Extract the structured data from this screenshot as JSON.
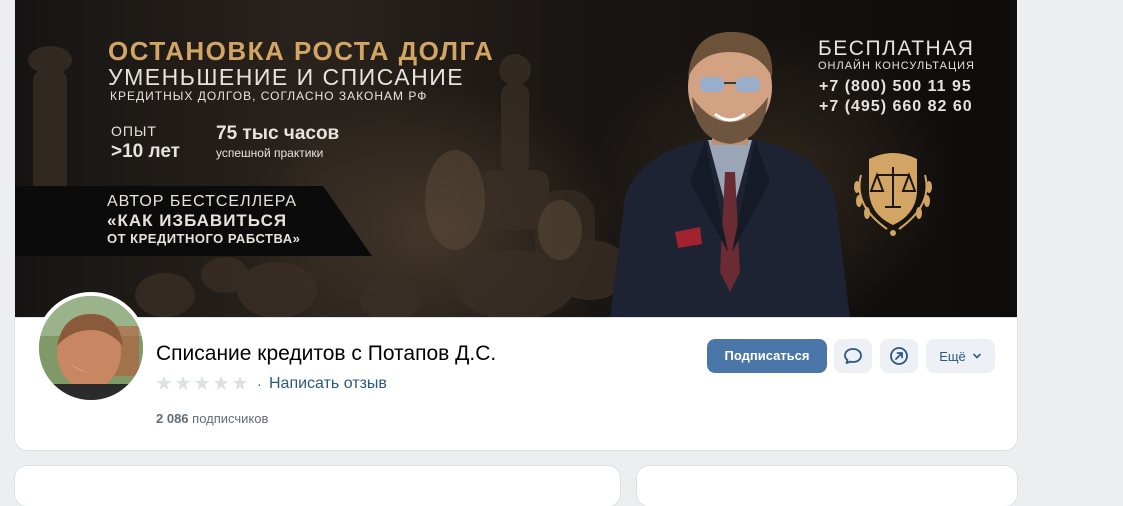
{
  "cover": {
    "headline": "ОСТАНОВКА РОСТА ДОЛГА",
    "subheadline": "УМЕНЬШЕНИЕ И СПИСАНИЕ",
    "subheadline2": "КРЕДИТНЫХ ДОЛГОВ, СОГЛАСНО ЗАКОНАМ РФ",
    "experience_label": "ОПЫТ",
    "experience_value": ">10 лет",
    "hours_value": "75 тыс часов",
    "hours_label": "успешной практики",
    "book_line1": "АВТОР БЕСТСЕЛЛЕРА",
    "book_line2": "«КАК ИЗБАВИТЬСЯ",
    "book_line3": "ОТ КРЕДИТНОГО РАБСТВА»",
    "consult_title": "БЕСПЛАТНАЯ",
    "consult_sub": "ОНЛАЙН КОНСУЛЬТАЦИЯ",
    "phone1": "+7 (800) 500 11 95",
    "phone2": "+7 (495) 660 82 60",
    "emblem_icon": "scales-of-justice-icon",
    "accent_color": "#d2a564"
  },
  "profile": {
    "title": "Списание кредитов с Потапов Д.С.",
    "rating_stars": 0,
    "rating_max": 5,
    "review_link": "Написать отзыв",
    "subscribers_count": "2 086",
    "subscribers_label": "подписчиков"
  },
  "actions": {
    "subscribe_label": "Подписаться",
    "message_icon": "message-bubble-icon",
    "share_icon": "share-arrow-icon",
    "more_label": "Ещё",
    "more_icon": "chevron-down-icon",
    "primary_color": "#4a76a8",
    "link_color": "#2a5885"
  }
}
